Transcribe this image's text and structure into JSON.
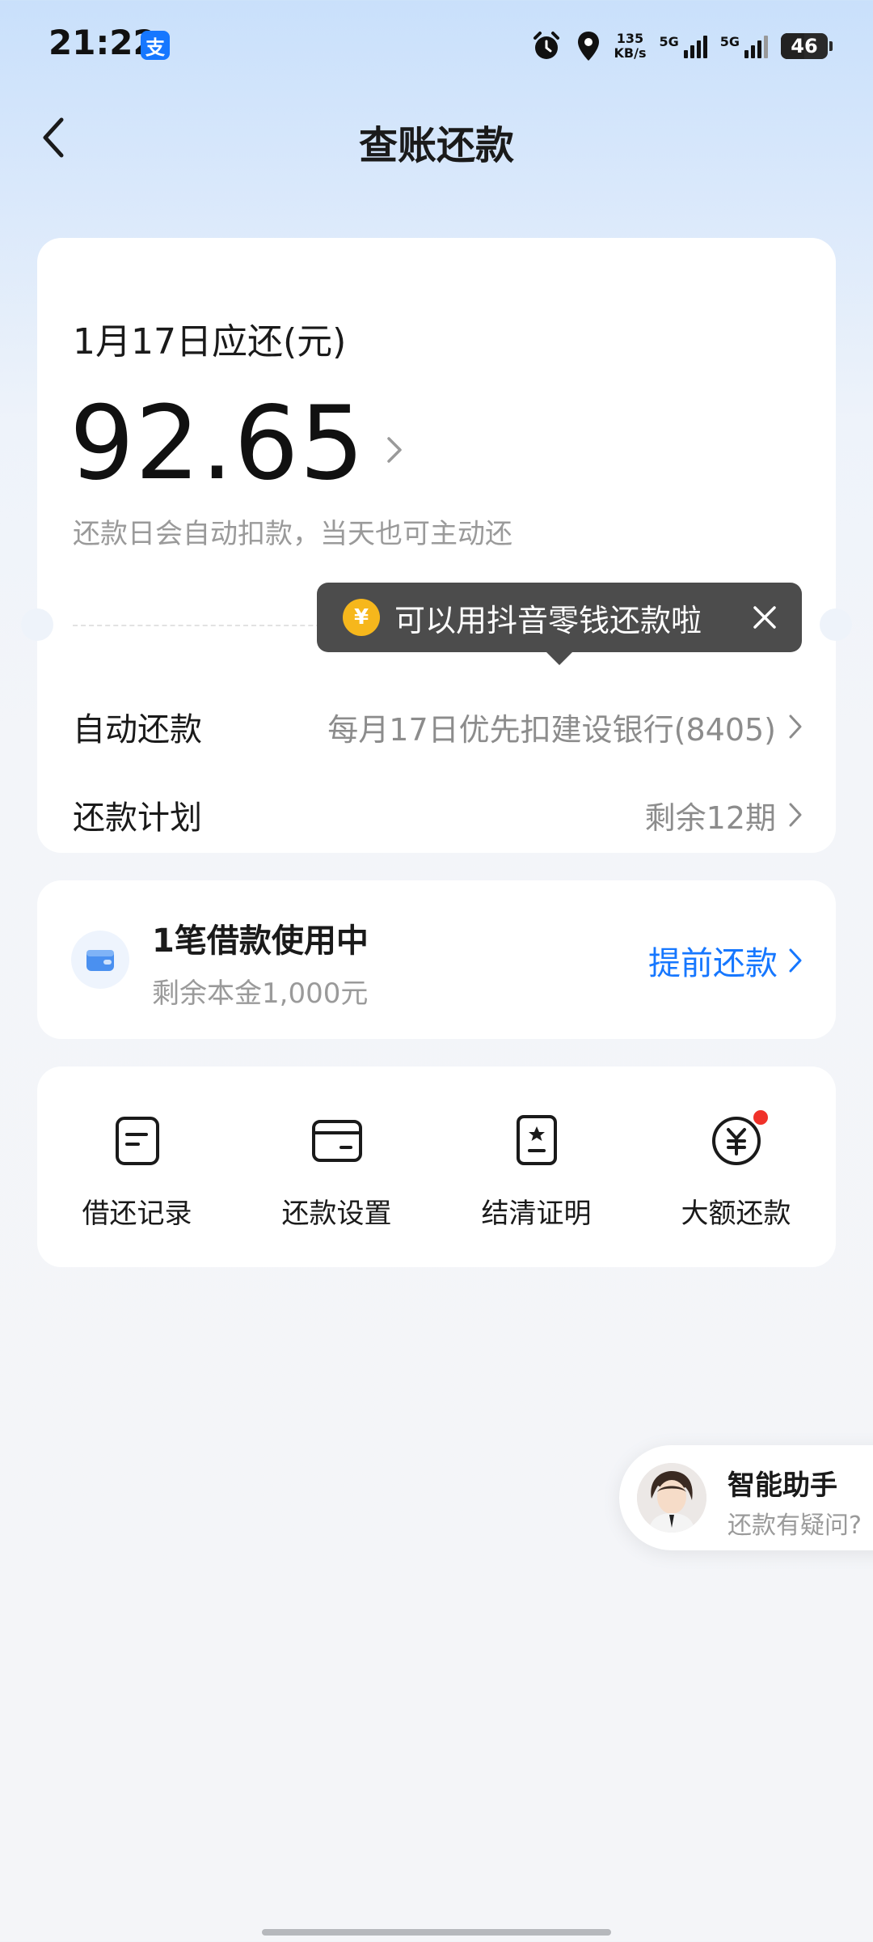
{
  "status_bar": {
    "time": "21:22",
    "app_badge": "支",
    "speed_value": "135",
    "speed_unit": "KB/s",
    "net1": "5G",
    "net2": "5G",
    "battery": "46",
    "icons": [
      "alarm-icon",
      "location-icon",
      "signal-icon",
      "battery-icon"
    ]
  },
  "header": {
    "title": "查账还款"
  },
  "bill": {
    "due_label": "1月17日应还(元)",
    "amount": "92.65",
    "hint": "还款日会自动扣款，当天也可主动还",
    "auto_repay_label": "自动还款",
    "auto_repay_value": "每月17日优先扣建设银行(8405)",
    "plan_label": "还款计划",
    "plan_value": "剩余12期"
  },
  "tooltip": {
    "coin_symbol": "¥",
    "text": "可以用抖音零钱还款啦"
  },
  "loan": {
    "title": "1笔借款使用中",
    "subtitle": "剩余本金1,000元",
    "action": "提前还款"
  },
  "shortcuts": [
    {
      "label": "借还记录",
      "icon": "record-icon"
    },
    {
      "label": "还款设置",
      "icon": "wallet-card-icon"
    },
    {
      "label": "结清证明",
      "icon": "certificate-icon"
    },
    {
      "label": "大额还款",
      "icon": "yuan-circle-icon"
    }
  ],
  "assistant": {
    "title": "智能助手",
    "subtitle": "还款有疑问?"
  },
  "colors": {
    "accent": "#1677ff",
    "tooltip_bg": "#4c4c4c",
    "coin": "#f6b71c",
    "badge_dot": "#f0322a"
  }
}
